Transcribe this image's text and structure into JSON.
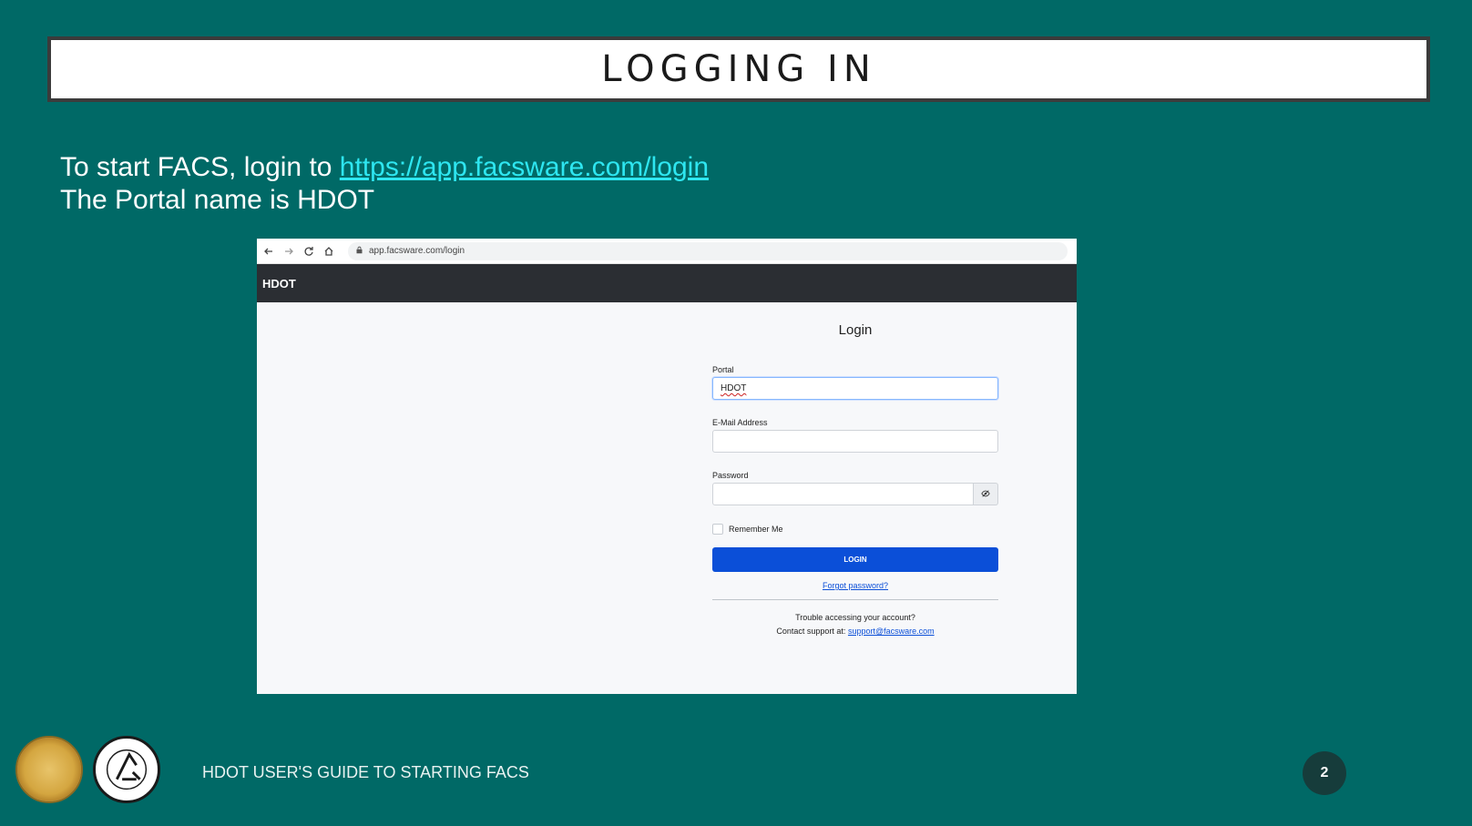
{
  "slide": {
    "title": "LOGGING IN",
    "intro_prefix": "To start FACS, login to ",
    "intro_link": "https://app.facsware.com/login",
    "intro_line2": "The Portal name is HDOT",
    "footer_text": "HDOT USER'S GUIDE TO STARTING FACS",
    "page_number": "2"
  },
  "browser": {
    "url": "app.facsware.com/login"
  },
  "app": {
    "header_title": "HDOT",
    "login": {
      "title": "Login",
      "portal_label": "Portal",
      "portal_value": "HDOT",
      "email_label": "E-Mail Address",
      "email_value": "",
      "password_label": "Password",
      "password_value": "",
      "remember_label": "Remember Me",
      "login_button": "LOGIN",
      "forgot_link": "Forgot password?",
      "trouble_text": "Trouble accessing your account?",
      "contact_prefix": "Contact support at: ",
      "support_email": "support@facsware.com"
    }
  },
  "icons": [
    "back-arrow-icon",
    "forward-arrow-icon",
    "reload-icon",
    "home-icon",
    "lock-icon",
    "eye-slash-icon"
  ],
  "colors": {
    "background": "#006966",
    "link": "#2ee6f0",
    "app_header": "#2b2e33",
    "login_button": "#0b4fd8"
  }
}
